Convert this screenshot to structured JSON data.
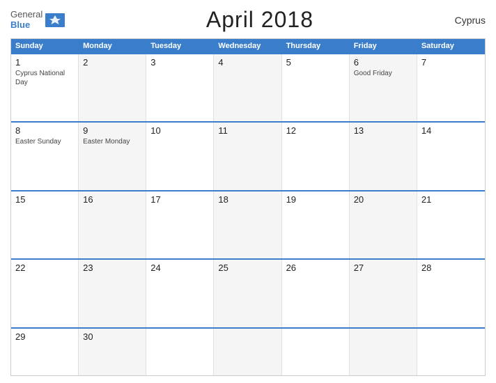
{
  "header": {
    "logo_line1": "General",
    "logo_line2": "Blue",
    "title": "April 2018",
    "country": "Cyprus"
  },
  "calendar": {
    "days": [
      "Sunday",
      "Monday",
      "Tuesday",
      "Wednesday",
      "Thursday",
      "Friday",
      "Saturday"
    ],
    "weeks": [
      [
        {
          "num": "1",
          "events": [
            "Cyprus National",
            "Day"
          ],
          "gray": false
        },
        {
          "num": "2",
          "events": [],
          "gray": true
        },
        {
          "num": "3",
          "events": [],
          "gray": false
        },
        {
          "num": "4",
          "events": [],
          "gray": true
        },
        {
          "num": "5",
          "events": [],
          "gray": false
        },
        {
          "num": "6",
          "events": [
            "Good Friday"
          ],
          "gray": true
        },
        {
          "num": "7",
          "events": [],
          "gray": false
        }
      ],
      [
        {
          "num": "8",
          "events": [
            "Easter Sunday"
          ],
          "gray": false
        },
        {
          "num": "9",
          "events": [
            "Easter Monday"
          ],
          "gray": true
        },
        {
          "num": "10",
          "events": [],
          "gray": false
        },
        {
          "num": "11",
          "events": [],
          "gray": true
        },
        {
          "num": "12",
          "events": [],
          "gray": false
        },
        {
          "num": "13",
          "events": [],
          "gray": true
        },
        {
          "num": "14",
          "events": [],
          "gray": false
        }
      ],
      [
        {
          "num": "15",
          "events": [],
          "gray": false
        },
        {
          "num": "16",
          "events": [],
          "gray": true
        },
        {
          "num": "17",
          "events": [],
          "gray": false
        },
        {
          "num": "18",
          "events": [],
          "gray": true
        },
        {
          "num": "19",
          "events": [],
          "gray": false
        },
        {
          "num": "20",
          "events": [],
          "gray": true
        },
        {
          "num": "21",
          "events": [],
          "gray": false
        }
      ],
      [
        {
          "num": "22",
          "events": [],
          "gray": false
        },
        {
          "num": "23",
          "events": [],
          "gray": true
        },
        {
          "num": "24",
          "events": [],
          "gray": false
        },
        {
          "num": "25",
          "events": [],
          "gray": true
        },
        {
          "num": "26",
          "events": [],
          "gray": false
        },
        {
          "num": "27",
          "events": [],
          "gray": true
        },
        {
          "num": "28",
          "events": [],
          "gray": false
        }
      ],
      [
        {
          "num": "29",
          "events": [],
          "gray": false
        },
        {
          "num": "30",
          "events": [],
          "gray": true
        },
        {
          "num": "",
          "events": [],
          "gray": false
        },
        {
          "num": "",
          "events": [],
          "gray": true
        },
        {
          "num": "",
          "events": [],
          "gray": false
        },
        {
          "num": "",
          "events": [],
          "gray": true
        },
        {
          "num": "",
          "events": [],
          "gray": false
        }
      ]
    ]
  }
}
